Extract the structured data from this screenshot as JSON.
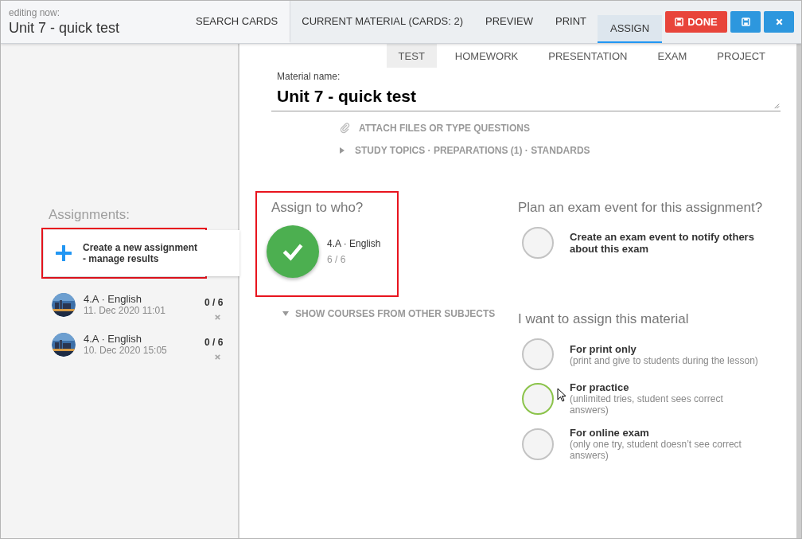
{
  "header": {
    "caption": "editing now:",
    "title": "Unit 7 - quick test"
  },
  "tabs": [
    {
      "label": "SEARCH CARDS",
      "selected": false
    },
    {
      "label": "CURRENT MATERIAL (CARDS: 2)",
      "selected": false
    },
    {
      "label": "PREVIEW",
      "selected": false
    },
    {
      "label": "PRINT",
      "selected": false
    },
    {
      "label": "ASSIGN",
      "selected": true
    }
  ],
  "actions": [
    {
      "kind": "done",
      "label": "DONE"
    },
    {
      "kind": "save"
    },
    {
      "kind": "close"
    }
  ],
  "sidebar": {
    "heading": "Assignments:",
    "create": {
      "line1": "Create a new assignment",
      "line2": "- manage results",
      "highlighted": true
    },
    "assignments": [
      {
        "course": "4.A · English",
        "date": "11. Dec 2020 11:01",
        "score": "0 / 6"
      },
      {
        "course": "4.A · English",
        "date": "10. Dec 2020 15:05",
        "score": "0 / 6"
      }
    ]
  },
  "material_types": [
    {
      "label": "TEST",
      "selected": true
    },
    {
      "label": "HOMEWORK",
      "selected": false
    },
    {
      "label": "PRESENTATION",
      "selected": false
    },
    {
      "label": "EXAM",
      "selected": false
    },
    {
      "label": "PROJECT",
      "selected": false
    }
  ],
  "material": {
    "label": "Material name:",
    "value": "Unit 7 - quick test",
    "attach": "ATTACH FILES OR TYPE QUESTIONS",
    "topics": "STUDY TOPICS · PREPARATIONS (1) · STANDARDS"
  },
  "assign": {
    "heading": "Assign to who?",
    "highlighted": true,
    "courses": [
      {
        "name": "4.A · English",
        "count": "6 / 6",
        "selected": true
      }
    ],
    "show_more": "SHOW COURSES FROM OTHER SUBJECTS"
  },
  "exam_event": {
    "heading": "Plan an exam event for this assignment?",
    "option": {
      "title": "Create an exam event to notify others about this exam",
      "checked": false
    }
  },
  "assign_mode": {
    "heading": "I want to assign this material",
    "options": [
      {
        "title": "For print only",
        "note": "(print and give to students during the lesson)",
        "checked": false,
        "hovered": false
      },
      {
        "title": "For practice",
        "note": "(unlimited tries, student sees correct answers)",
        "checked": false,
        "hovered": true
      },
      {
        "title": "For online exam",
        "note": "(only one try, student doesn’t see correct answers)",
        "checked": false,
        "hovered": false
      }
    ]
  }
}
